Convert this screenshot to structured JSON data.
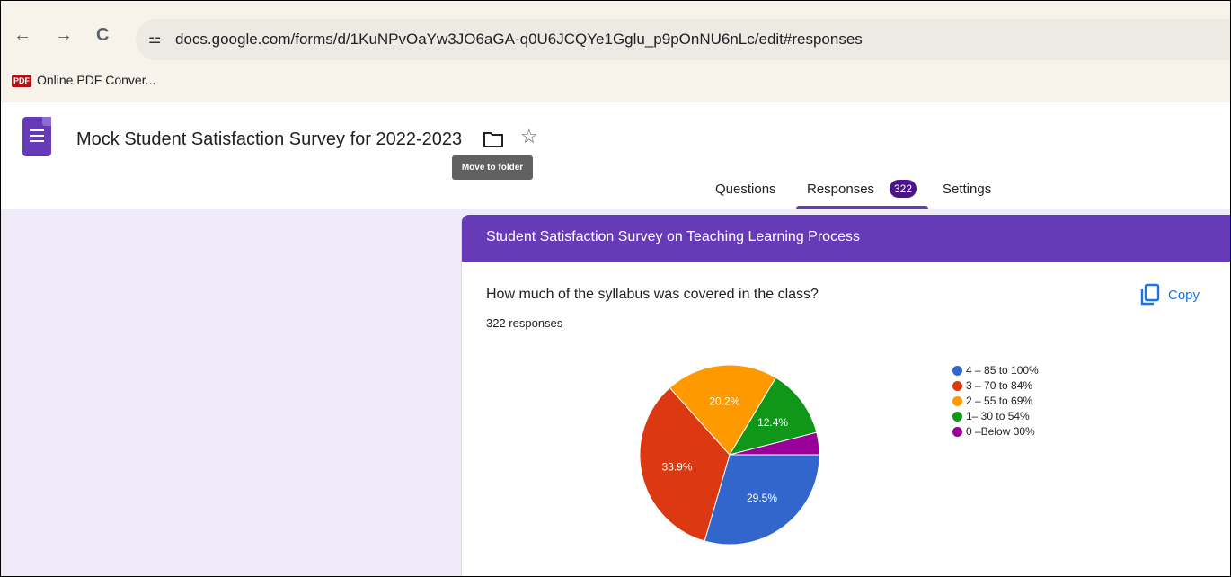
{
  "browser": {
    "back_icon": "←",
    "forward_icon": "→",
    "reload_icon": "C",
    "site_settings_icon": "⚍",
    "url": "docs.google.com/forms/d/1KuNPvOaYw3JO6aGA-q0U6JCQYe1Gglu_p9pOnNU6nLc/edit#responses",
    "bookmark": {
      "icon_text": "PDF",
      "label": "Online PDF Conver..."
    }
  },
  "header": {
    "form_title": "Mock Student Satisfaction Survey for 2022-2023",
    "star_icon": "☆",
    "tooltip": "Move to folder",
    "tabs": {
      "questions": "Questions",
      "responses": "Responses",
      "responses_count": "322",
      "settings": "Settings"
    }
  },
  "card": {
    "section_title": "Student Satisfaction Survey on Teaching Learning Process",
    "question": "How much of the syllabus was covered in the class?",
    "response_count": "322 responses",
    "copy_label": "Copy"
  },
  "chart_data": {
    "type": "pie",
    "slices": [
      {
        "label": "4 – 85 to 100%",
        "value": 29.5,
        "color": "#3366cc",
        "data_label": "29.5%"
      },
      {
        "label": "3 – 70 to 84%",
        "value": 33.9,
        "color": "#dc3912",
        "data_label": "33.9%"
      },
      {
        "label": "2 – 55 to 69%",
        "value": 20.2,
        "color": "#ff9900",
        "data_label": "20.2%"
      },
      {
        "label": "1– 30 to 54%",
        "value": 12.4,
        "color": "#109618",
        "data_label": "12.4%"
      },
      {
        "label": "0 –Below 30%",
        "value": 4.0,
        "color": "#990099",
        "data_label": ""
      }
    ],
    "legend_position": "right"
  },
  "colors": {
    "accent": "#673ab7",
    "badge": "#4a148c",
    "copy": "#1a73e8"
  }
}
